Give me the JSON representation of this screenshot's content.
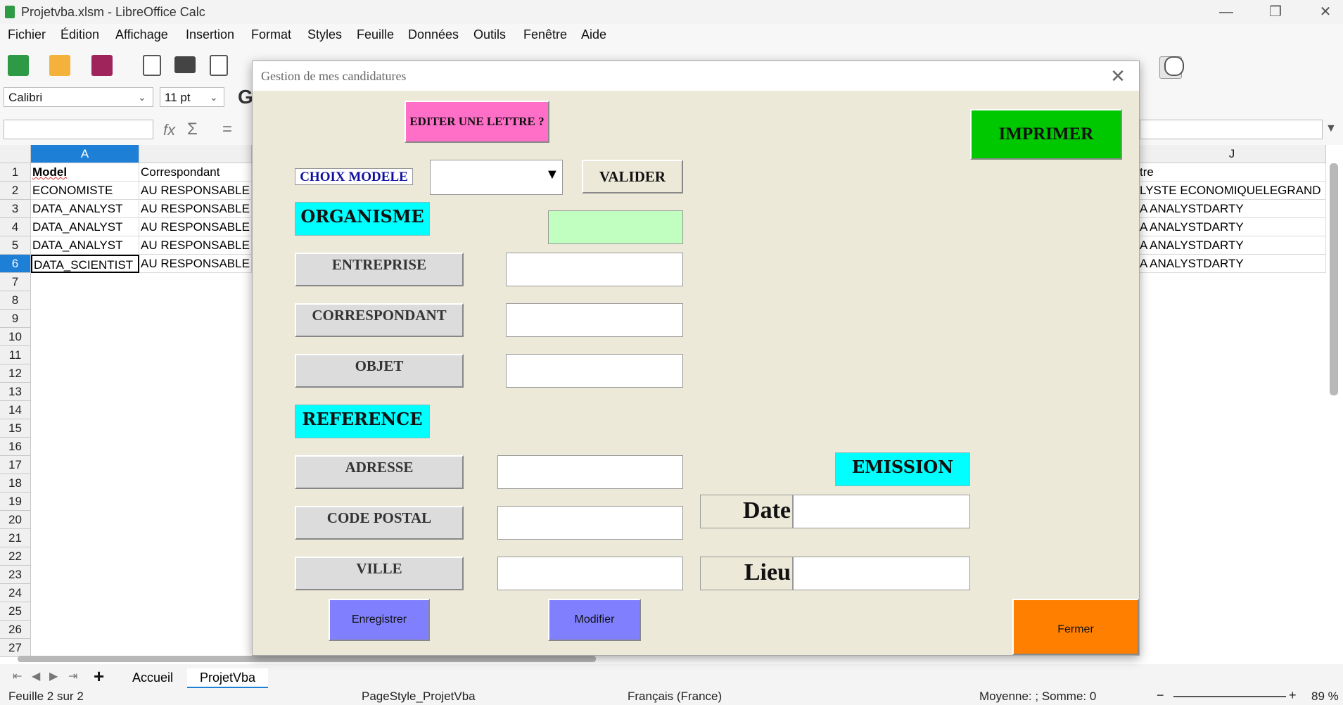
{
  "window": {
    "title": "Projetvba.xlsm - LibreOffice Calc",
    "controls": [
      "—",
      "❐",
      "✕"
    ]
  },
  "menu": [
    "Fichier",
    "Édition",
    "Affichage",
    "Insertion",
    "Format",
    "Styles",
    "Feuille",
    "Données",
    "Outils",
    "Fenêtre",
    "Aide"
  ],
  "toolbar": {
    "font_name": "Calibri",
    "font_size": "11 pt",
    "bold_glyph": "G"
  },
  "formula": {
    "fx": "fx",
    "sum": "Σ",
    "equals": "="
  },
  "grid": {
    "columns": [
      "A",
      "J"
    ],
    "rows": [
      "1",
      "2",
      "3",
      "4",
      "5",
      "6",
      "7",
      "8",
      "9",
      "10",
      "11",
      "12",
      "13",
      "14",
      "15",
      "16",
      "17",
      "18",
      "19",
      "20",
      "21",
      "22",
      "23",
      "24",
      "25",
      "26",
      "27"
    ],
    "col_a": [
      "Model",
      "ECONOMISTE",
      "DATA_ANALYST",
      "DATA_ANALYST",
      "DATA_ANALYST",
      "DATA_SCIENTIST"
    ],
    "col_b": [
      "Correspondant",
      "AU RESPONSABLE D",
      "AU RESPONSABLE II",
      "AU RESPONSABLE II",
      "AU RESPONSABLE II",
      "AU RESPONSABLE II"
    ],
    "col_j": [
      "tre",
      "LYSTE ECONOMIQUELEGRAND",
      "A ANALYSTDARTY",
      "A ANALYSTDARTY",
      "A ANALYSTDARTY",
      "A ANALYSTDARTY"
    ]
  },
  "sheets": {
    "tabs": [
      "Accueil",
      "ProjetVba"
    ],
    "active": "ProjetVba",
    "add": "+"
  },
  "status": {
    "sheet": "Feuille 2 sur 2",
    "pagestyle": "PageStyle_ProjetVba",
    "language": "Français (France)",
    "stats": "Moyenne: ; Somme: 0",
    "zoom": "89 %"
  },
  "dialog": {
    "title": "Gestion de mes candidatures",
    "editer_btn": "EDITER UNE LETTRE ?",
    "imprimer_btn": "IMPRIMER",
    "choix_modele": "CHOIX MODELE",
    "valider_btn": "VALIDER",
    "organisme": "ORGANISME",
    "entreprise": "ENTREPRISE",
    "correspondant": "CORRESPONDANT",
    "objet": "OBJET",
    "reference": "REFERENCE",
    "adresse": "ADRESSE",
    "code_postal": "CODE POSTAL",
    "ville": "VILLE",
    "emission": "EMISSION",
    "date": "Date",
    "lieu": "Lieu",
    "enregistrer_btn": "Enregistrer",
    "modifier_btn": "Modifier",
    "fermer_btn": "Fermer",
    "colors": {
      "pink": "#ff6ec7",
      "green": "#00c800",
      "cyan": "#00ffff",
      "light_green": "#c0ffc0",
      "periwinkle": "#8080ff",
      "orange": "#ff8000"
    }
  }
}
